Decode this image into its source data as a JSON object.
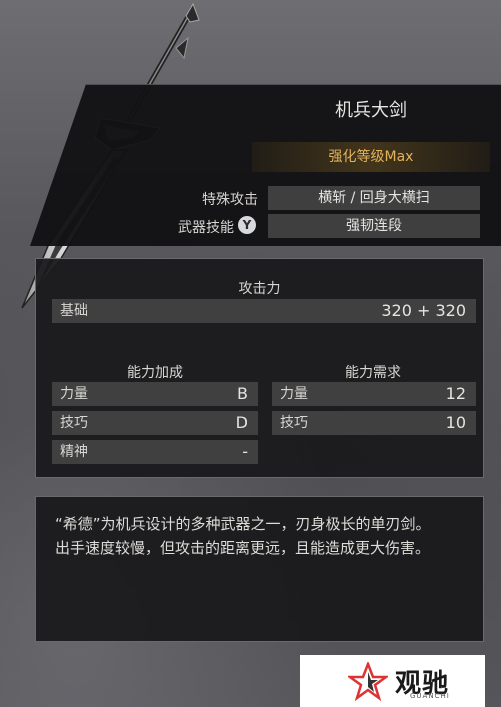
{
  "weapon": {
    "name": "机兵大剑",
    "enhancement": "强化等级Max",
    "special_attack_label": "特殊攻击",
    "special_attack_value": "横斩 / 回身大横扫",
    "weapon_skill_label": "武器技能",
    "weapon_skill_button": "Y",
    "weapon_skill_value": "强韧连段"
  },
  "attack": {
    "title": "攻击力",
    "base_label": "基础",
    "base_value": "320 + 320"
  },
  "scaling": {
    "title": "能力加成",
    "rows": [
      {
        "label": "力量",
        "value": "B"
      },
      {
        "label": "技巧",
        "value": "D"
      },
      {
        "label": "精神",
        "value": "-"
      }
    ]
  },
  "requirements": {
    "title": "能力需求",
    "rows": [
      {
        "label": "力量",
        "value": "12"
      },
      {
        "label": "技巧",
        "value": "10"
      }
    ]
  },
  "description": {
    "line1": "“希德”为机兵设计的多种武器之一，刃身极长的单刃剑。",
    "line2": "出手速度较慢，但攻击的距离更远，且能造成更大伤害。"
  },
  "watermark": {
    "brand": "观驰",
    "sub": "GUANCHI"
  },
  "colors": {
    "enhancement_gold": "#e2b35c",
    "panel_bg": "#1a1a1c",
    "bar_bg": "#464648"
  }
}
